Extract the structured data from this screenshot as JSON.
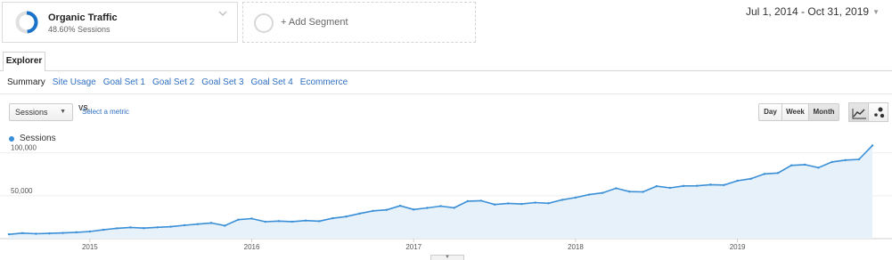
{
  "segments": {
    "active": {
      "name": "Organic Traffic",
      "percent": "48.60% Sessions",
      "fraction": 0.486,
      "color": "#1a73c9"
    },
    "add_label": "+ Add Segment"
  },
  "date_range": {
    "label": "Jul 1, 2014 - Oct 31, 2019"
  },
  "tabs": {
    "explorer": "Explorer"
  },
  "subtabs": [
    "Summary",
    "Site Usage",
    "Goal Set 1",
    "Goal Set 2",
    "Goal Set 3",
    "Goal Set 4",
    "Ecommerce"
  ],
  "controls": {
    "metric": "Sessions",
    "vs": "VS.",
    "select_metric": "Select a metric",
    "granularity": {
      "day": "Day",
      "week": "Week",
      "month": "Month",
      "selected": "Month"
    }
  },
  "icons": {
    "segment_chevron": "chevron-down-icon",
    "line_chart": "line-chart-icon",
    "motion_chart": "motion-chart-icon",
    "scroll": "chevron-down-icon"
  },
  "colors": {
    "series": "#3a8fd6",
    "fill": "#e6f1fa",
    "link": "#2e6fc2"
  },
  "chart_data": {
    "type": "area",
    "series": [
      {
        "name": "Sessions",
        "values": [
          5000,
          6400,
          5700,
          6100,
          6600,
          7400,
          8300,
          10300,
          12000,
          13100,
          12200,
          13200,
          13900,
          15600,
          16900,
          18300,
          15100,
          22100,
          23400,
          19700,
          20400,
          19800,
          21100,
          20300,
          23800,
          25700,
          29300,
          32400,
          33500,
          38300,
          33900,
          35800,
          37900,
          35900,
          43700,
          44200,
          39700,
          41100,
          40400,
          42000,
          41200,
          45200,
          47800,
          51300,
          53300,
          58700,
          54800,
          54500,
          61100,
          59200,
          61400,
          61500,
          62900,
          62500,
          67500,
          69800,
          75400,
          76500,
          85400,
          86200,
          82700,
          89300,
          91500,
          92400,
          108500
        ]
      }
    ],
    "x_start": "2014-07",
    "x_end": "2019-10",
    "x_ticks": [
      "2015",
      "2016",
      "2017",
      "2018",
      "2019"
    ],
    "y_ticks": [
      "100,000",
      "50,000"
    ],
    "ylim": [
      0,
      110000
    ],
    "grid": true,
    "legend": "top-left"
  }
}
